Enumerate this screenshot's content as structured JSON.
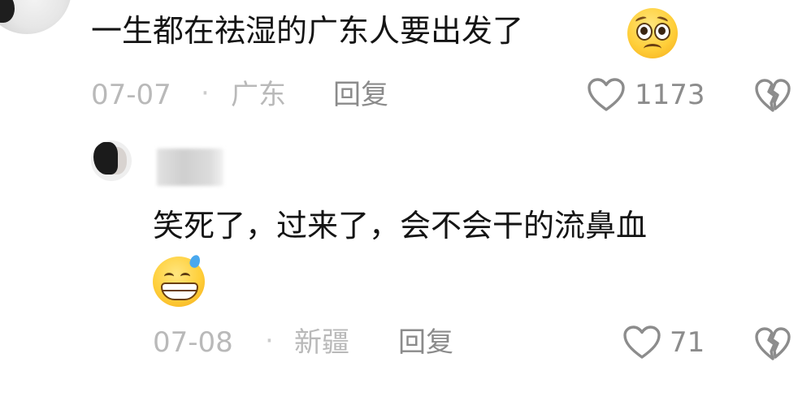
{
  "comments": [
    {
      "text": "一生都在祛湿的广东人要出发了",
      "emoji": "pleading-face-icon",
      "date": "07-07",
      "separator": "·",
      "location": "广东",
      "reply_label": "回复",
      "likes": "1173"
    }
  ],
  "replies": [
    {
      "text": "笑死了，过来了，会不会干的流鼻血",
      "emoji": "grinning-sweat-face-icon",
      "date": "07-08",
      "separator": "·",
      "location": "新疆",
      "reply_label": "回复",
      "likes": "71"
    }
  ],
  "colors": {
    "text": "#141414",
    "meta": "#b9b9b9",
    "action": "#8b8b8b",
    "background": "#ffffff"
  }
}
